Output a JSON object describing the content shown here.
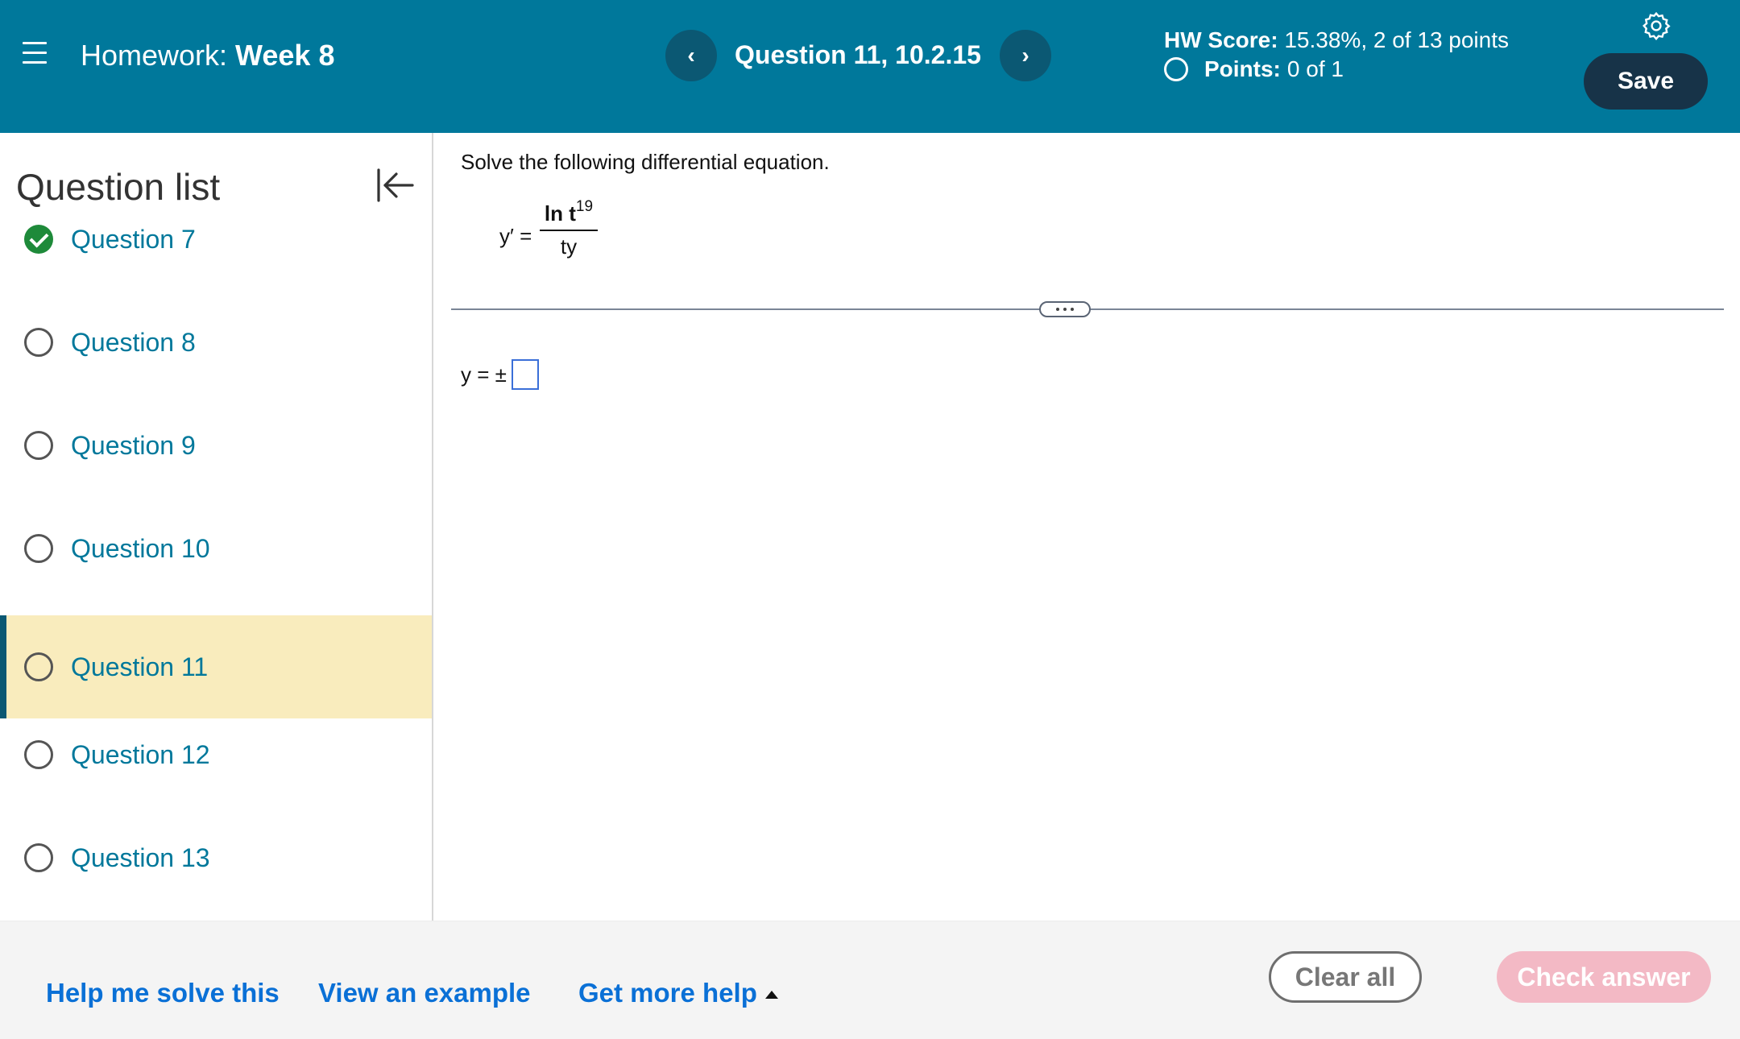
{
  "header": {
    "menu_icon": "hamburger-menu-icon",
    "title_prefix": "Homework:",
    "title_name": "Week 8",
    "question_title": "Question 11, 10.2.15",
    "prev_icon": "chevron-left-icon",
    "prev_label": "‹",
    "next_icon": "chevron-right-icon",
    "next_label": "›",
    "score_label": "HW Score:",
    "score_value": "15.38%, 2 of 13 points",
    "points_label": "Points:",
    "points_value": "0 of 1",
    "settings_icon": "gear-icon",
    "save_label": "Save",
    "colors": {
      "header_bg": "#00789b",
      "nav_button_bg": "#0b5873",
      "save_bg": "#173348"
    }
  },
  "sidebar": {
    "title": "Question list",
    "collapse_icon": "collapse-left-icon",
    "items": [
      {
        "label": "Question 7",
        "status": "complete"
      },
      {
        "label": "Question 8",
        "status": "unanswered"
      },
      {
        "label": "Question 9",
        "status": "unanswered"
      },
      {
        "label": "Question 10",
        "status": "unanswered"
      },
      {
        "label": "Question 11",
        "status": "current"
      },
      {
        "label": "Question 12",
        "status": "unanswered"
      },
      {
        "label": "Question 13",
        "status": "unanswered"
      }
    ],
    "colors": {
      "active_bg": "#f9ecbd",
      "link": "#00789b",
      "complete": "#1e8a3a"
    }
  },
  "main": {
    "instructions": "Solve the following differential equation.",
    "equation": {
      "lhs": "y′ =",
      "numerator_base": "ln t",
      "numerator_exponent": "19",
      "denominator": "ty"
    },
    "more_icon": "ellipsis-icon",
    "answer_prefix": "y = ±",
    "answer_value": ""
  },
  "footer": {
    "help_solve": "Help me solve this",
    "view_example": "View an example",
    "more_help": "Get more help",
    "more_help_icon": "caret-up-icon",
    "clear_all": "Clear all",
    "check_answer": "Check answer",
    "colors": {
      "link": "#0a70d6",
      "check_answer_bg": "#f3b9c5"
    }
  }
}
